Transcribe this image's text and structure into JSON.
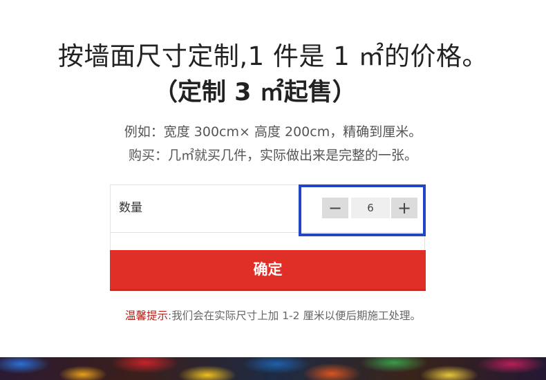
{
  "header": {
    "title_line1": "按墙面尺寸定制,1 件是 1 ㎡的价格。",
    "title_line2": "（定制 3 ㎡起售）"
  },
  "description": {
    "line1": "例如：宽度 300cm× 高度 200cm，精确到厘米。",
    "line2": "购买：几㎡就买几件，实际做出来是完整的一张。"
  },
  "quantity": {
    "label": "数量",
    "value": "6",
    "decrement_symbol": "−",
    "increment_symbol": "+"
  },
  "confirm_button": {
    "label": "确定",
    "color": "#e02f26"
  },
  "tip": {
    "label": "温馨提示",
    "separator": ":",
    "text": "我们会在实际尺寸上加 1-2 厘米以便后期施工处理。"
  },
  "colors": {
    "highlight_frame": "#2345c8",
    "tip_label": "#b3201a"
  },
  "icons": {
    "decrement": "minus-icon",
    "increment": "plus-icon"
  }
}
